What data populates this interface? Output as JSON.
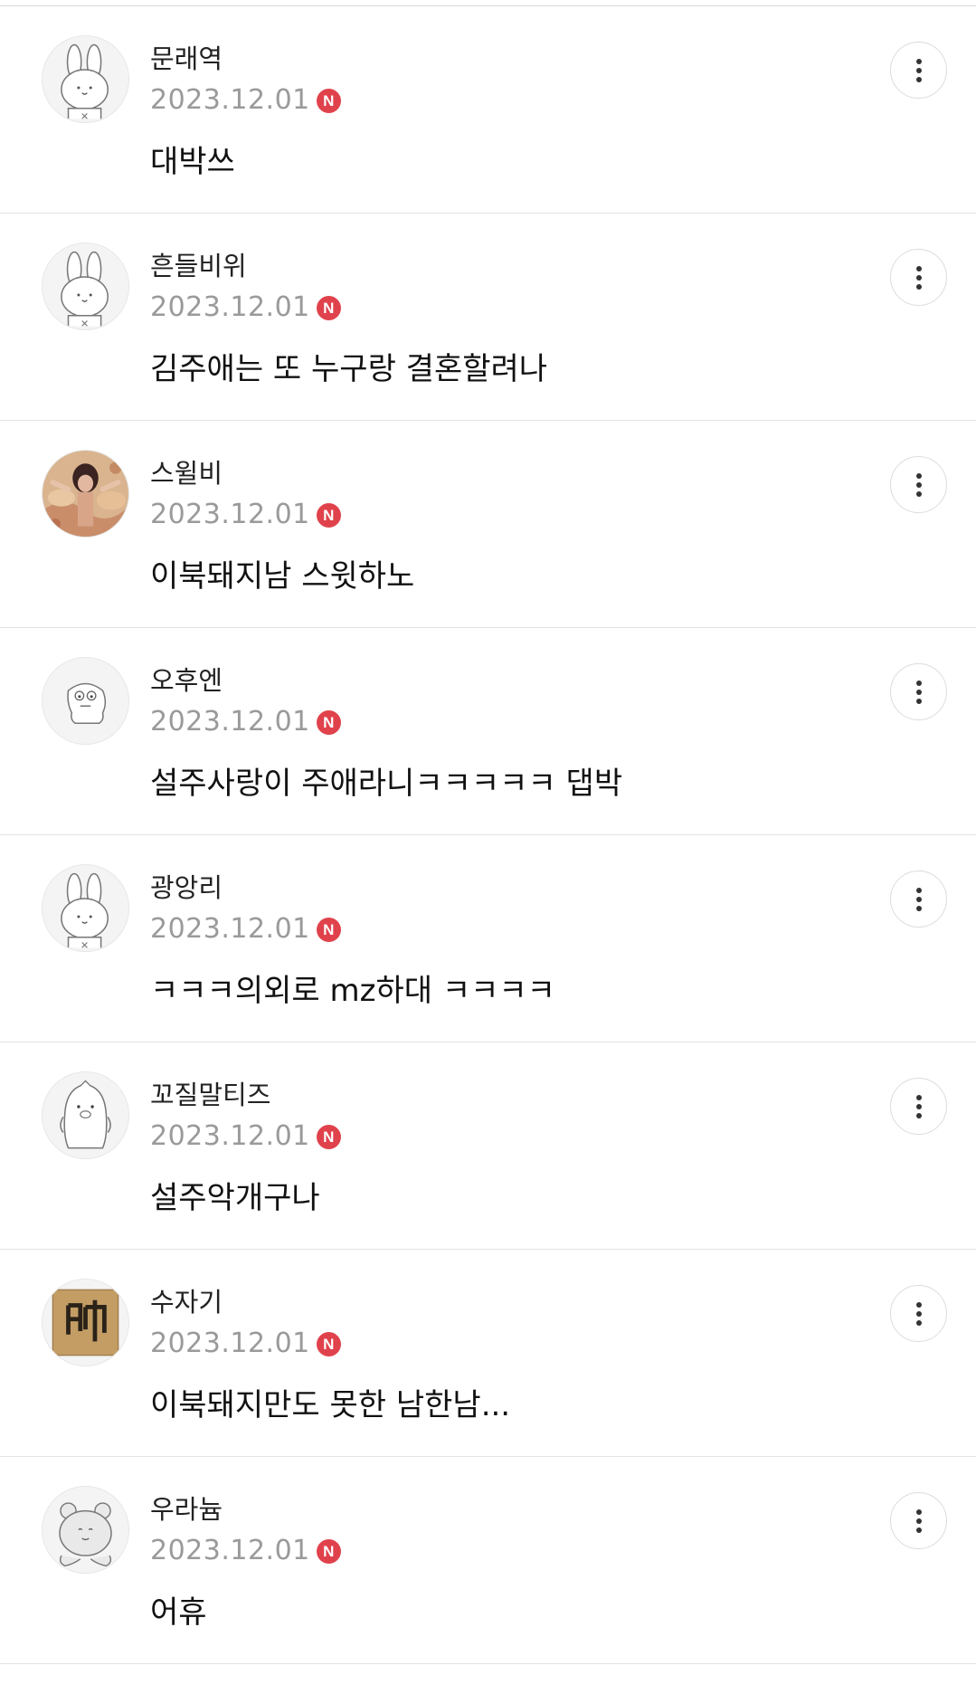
{
  "comments": [
    {
      "nickname": "문래역",
      "date": "2023.12.01",
      "badge": "N",
      "text": "대박쓰",
      "avatar": "rabbit-avatar"
    },
    {
      "nickname": "흔들비위",
      "date": "2023.12.01",
      "badge": "N",
      "text": "김주애는 또 누구랑 결혼할려나",
      "avatar": "rabbit-avatar"
    },
    {
      "nickname": "스윌비",
      "date": "2023.12.01",
      "badge": "N",
      "text": "이북돼지남 스윗하노",
      "avatar": "photo-avatar"
    },
    {
      "nickname": "오후엔",
      "date": "2023.12.01",
      "badge": "N",
      "text": "설주사랑이 주애라니ㅋㅋㅋㅋㅋ 댑박",
      "avatar": "blob-avatar"
    },
    {
      "nickname": "광앙리",
      "date": "2023.12.01",
      "badge": "N",
      "text": "ㅋㅋㅋ의외로 mz하대 ㅋㅋㅋㅋ",
      "avatar": "rabbit-avatar"
    },
    {
      "nickname": "꼬질말티즈",
      "date": "2023.12.01",
      "badge": "N",
      "text": "설주악개구나",
      "avatar": "penguin-avatar"
    },
    {
      "nickname": "수자기",
      "date": "2023.12.01",
      "badge": "N",
      "text": "이북돼지만도 못한 남한남...",
      "avatar": "flag-avatar"
    },
    {
      "nickname": "우라늄",
      "date": "2023.12.01",
      "badge": "N",
      "text": "어휴",
      "avatar": "bear-avatar"
    }
  ],
  "colors": {
    "badge": "#e0424c",
    "date": "#9a9a9a",
    "divider": "#e3e3e3"
  },
  "icons": {
    "more": "more-vertical-icon"
  }
}
